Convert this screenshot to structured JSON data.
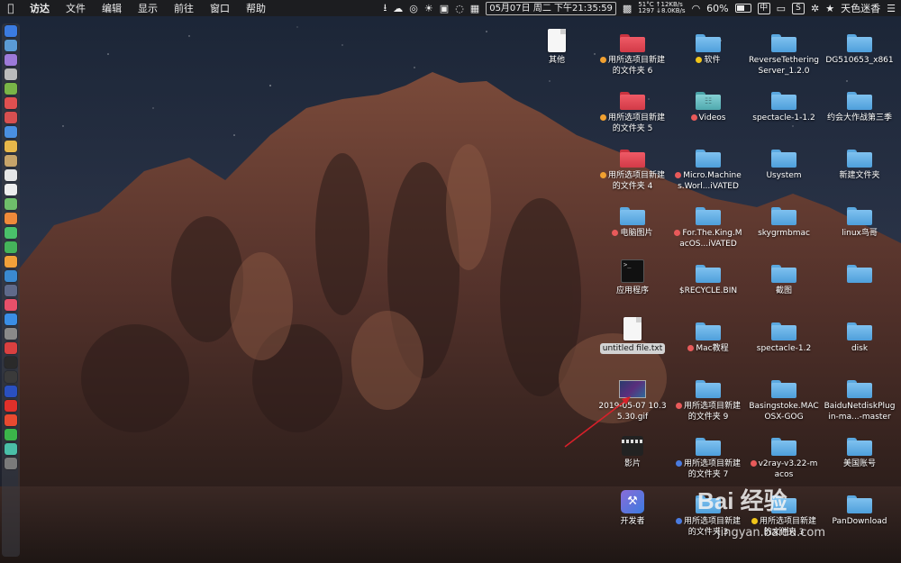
{
  "menubar": {
    "apple_icon": "apple-icon",
    "items": [
      {
        "label": "访达",
        "bold": true
      },
      {
        "label": "文件"
      },
      {
        "label": "编辑"
      },
      {
        "label": "显示"
      },
      {
        "label": "前往"
      },
      {
        "label": "窗口"
      },
      {
        "label": "帮助"
      }
    ],
    "status": {
      "cpu_temp": "51°C",
      "fan_speed": "1297",
      "upload": "↑12KB/s",
      "download": "↓8.0KB/s",
      "datetime": "05月07日 周二 下午21:35:59",
      "battery": "60%",
      "battery_level": 0.6,
      "ime_label": "中",
      "ime_box": "S",
      "user_label": "天色迷香"
    }
  },
  "dock": {
    "items": [
      "finder-icon",
      "siri-icon",
      "launchpad-icon",
      "safari-icon",
      "android-icon",
      "app-icon",
      "app-icon",
      "safari-icon",
      "photos-icon",
      "notes-icon",
      "calendar-icon",
      "notes-icon",
      "maps-icon",
      "photos-icon",
      "messages-icon",
      "facetime-icon",
      "pages-icon",
      "app-icon",
      "presentation-icon",
      "music-icon",
      "app-store-icon",
      "preferences-icon",
      "vivaldi-icon",
      "terminal-icon",
      "app-icon",
      "vpn-icon",
      "yandex-icon",
      "weibo-icon",
      "wechat-icon",
      "app-icon",
      "trash-icon"
    ]
  },
  "desktop_items": [
    {
      "id": "qita",
      "label": "其他",
      "kind": "doc",
      "icon": "document-icon"
    },
    {
      "id": "f6",
      "label": "用所选项目新建的文件夹 6",
      "kind": "folder-red",
      "icon": "folder-icon",
      "tag": "#f0a030"
    },
    {
      "id": "soft",
      "label": "软件",
      "kind": "folder-blue",
      "icon": "folder-icon",
      "tag": "#f0c419"
    },
    {
      "id": "reverse",
      "label": "ReverseTetheringServer_1.2.0",
      "kind": "folder-blue",
      "icon": "folder-icon"
    },
    {
      "id": "dg",
      "label": "DG510653_x861",
      "kind": "folder-blue",
      "icon": "folder-icon"
    },
    {
      "id": "f5",
      "label": "用所选项目新建的文件夹 5",
      "kind": "folder-red",
      "icon": "folder-icon",
      "tag": "#f0a030"
    },
    {
      "id": "videos",
      "label": "Videos",
      "kind": "folder-teal",
      "icon": "folder-icon",
      "tag": "#e85a5a"
    },
    {
      "id": "spectacle112",
      "label": "spectacle-1-1.2",
      "kind": "folder-blue",
      "icon": "folder-icon"
    },
    {
      "id": "yuehui",
      "label": "约会大作战第三季",
      "kind": "folder-blue",
      "icon": "folder-icon"
    },
    {
      "id": "f4",
      "label": "用所选项目新建的文件夹 4",
      "kind": "folder-red",
      "icon": "folder-icon",
      "tag": "#f0a030"
    },
    {
      "id": "micro",
      "label": "Micro.Machines.Worl...iVATED",
      "kind": "folder-blue",
      "icon": "folder-icon",
      "tag": "#e85a5a"
    },
    {
      "id": "usystem",
      "label": "Usystem",
      "kind": "folder-blue",
      "icon": "folder-icon"
    },
    {
      "id": "newfolder",
      "label": "新建文件夹",
      "kind": "folder-blue",
      "icon": "folder-icon"
    },
    {
      "id": "pcimg",
      "label": "电脑图片",
      "kind": "folder-blue",
      "icon": "folder-icon",
      "tag": "#e85a5a"
    },
    {
      "id": "king",
      "label": "For.The.King.MacOS...iVATED",
      "kind": "folder-blue",
      "icon": "folder-icon",
      "tag": "#e85a5a"
    },
    {
      "id": "skygrm",
      "label": "skygrmbmac",
      "kind": "folder-blue",
      "icon": "folder-icon"
    },
    {
      "id": "linux",
      "label": "linux鸟哥",
      "kind": "folder-blue",
      "icon": "folder-icon"
    },
    {
      "id": "apps",
      "label": "应用程序",
      "kind": "exec",
      "icon": "executable-icon"
    },
    {
      "id": "recycle",
      "label": "$RECYCLE.BIN",
      "kind": "folder-blue",
      "icon": "folder-icon"
    },
    {
      "id": "jietu",
      "label": "截图",
      "kind": "folder-blue",
      "icon": "folder-icon"
    },
    {
      "id": "blank1",
      "label": "",
      "kind": "folder-blue",
      "icon": "folder-icon"
    },
    {
      "id": "untitled",
      "label": "untitled file.txt",
      "kind": "doc",
      "icon": "text-file-icon",
      "selected": true
    },
    {
      "id": "mac",
      "label": "Mac教程",
      "kind": "folder-blue",
      "icon": "folder-icon",
      "tag": "#e85a5a"
    },
    {
      "id": "spectacle12",
      "label": "spectacle-1.2",
      "kind": "folder-blue",
      "icon": "folder-icon"
    },
    {
      "id": "disk",
      "label": "disk",
      "kind": "folder-blue",
      "icon": "folder-icon"
    },
    {
      "id": "gif",
      "label": "2019-05-07 10.35.30.gif",
      "kind": "gif",
      "icon": "gif-file-icon"
    },
    {
      "id": "f9",
      "label": "用所选项目新建的文件夹 9",
      "kind": "folder-blue",
      "icon": "folder-icon",
      "tag": "#e85a5a"
    },
    {
      "id": "basing",
      "label": "Basingstoke.MACOSX-GOG",
      "kind": "folder-blue",
      "icon": "folder-icon"
    },
    {
      "id": "baidu",
      "label": "BaiduNetdiskPlugin-ma...-master",
      "kind": "folder-blue",
      "icon": "folder-icon"
    },
    {
      "id": "yingpian",
      "label": "影片",
      "kind": "movie",
      "icon": "movie-icon"
    },
    {
      "id": "f7",
      "label": "用所选项目新建的文件夹 7",
      "kind": "folder-blue",
      "icon": "folder-icon",
      "tag": "#4a7be0"
    },
    {
      "id": "v2ray",
      "label": "v2ray-v3.22-macos",
      "kind": "folder-blue",
      "icon": "folder-icon",
      "tag": "#e85a5a"
    },
    {
      "id": "meiguo",
      "label": "美国账号",
      "kind": "folder-blue",
      "icon": "folder-icon"
    },
    {
      "id": "dev",
      "label": "开发者",
      "kind": "dev",
      "icon": "developer-app-icon"
    },
    {
      "id": "f3",
      "label": "用所选项目新建的文件夹 3",
      "kind": "folder-blue",
      "icon": "folder-icon",
      "tag": "#4a7be0"
    },
    {
      "id": "f3b",
      "label": "用所选项目新建的文件夹 3",
      "kind": "folder-blue",
      "icon": "folder-icon",
      "tag": "#f0c419"
    },
    {
      "id": "pandl",
      "label": "PanDownload",
      "kind": "folder-blue",
      "icon": "folder-icon"
    }
  ],
  "watermark": {
    "logo": "Bai 经验",
    "url": "jingyan.baidu.com"
  }
}
